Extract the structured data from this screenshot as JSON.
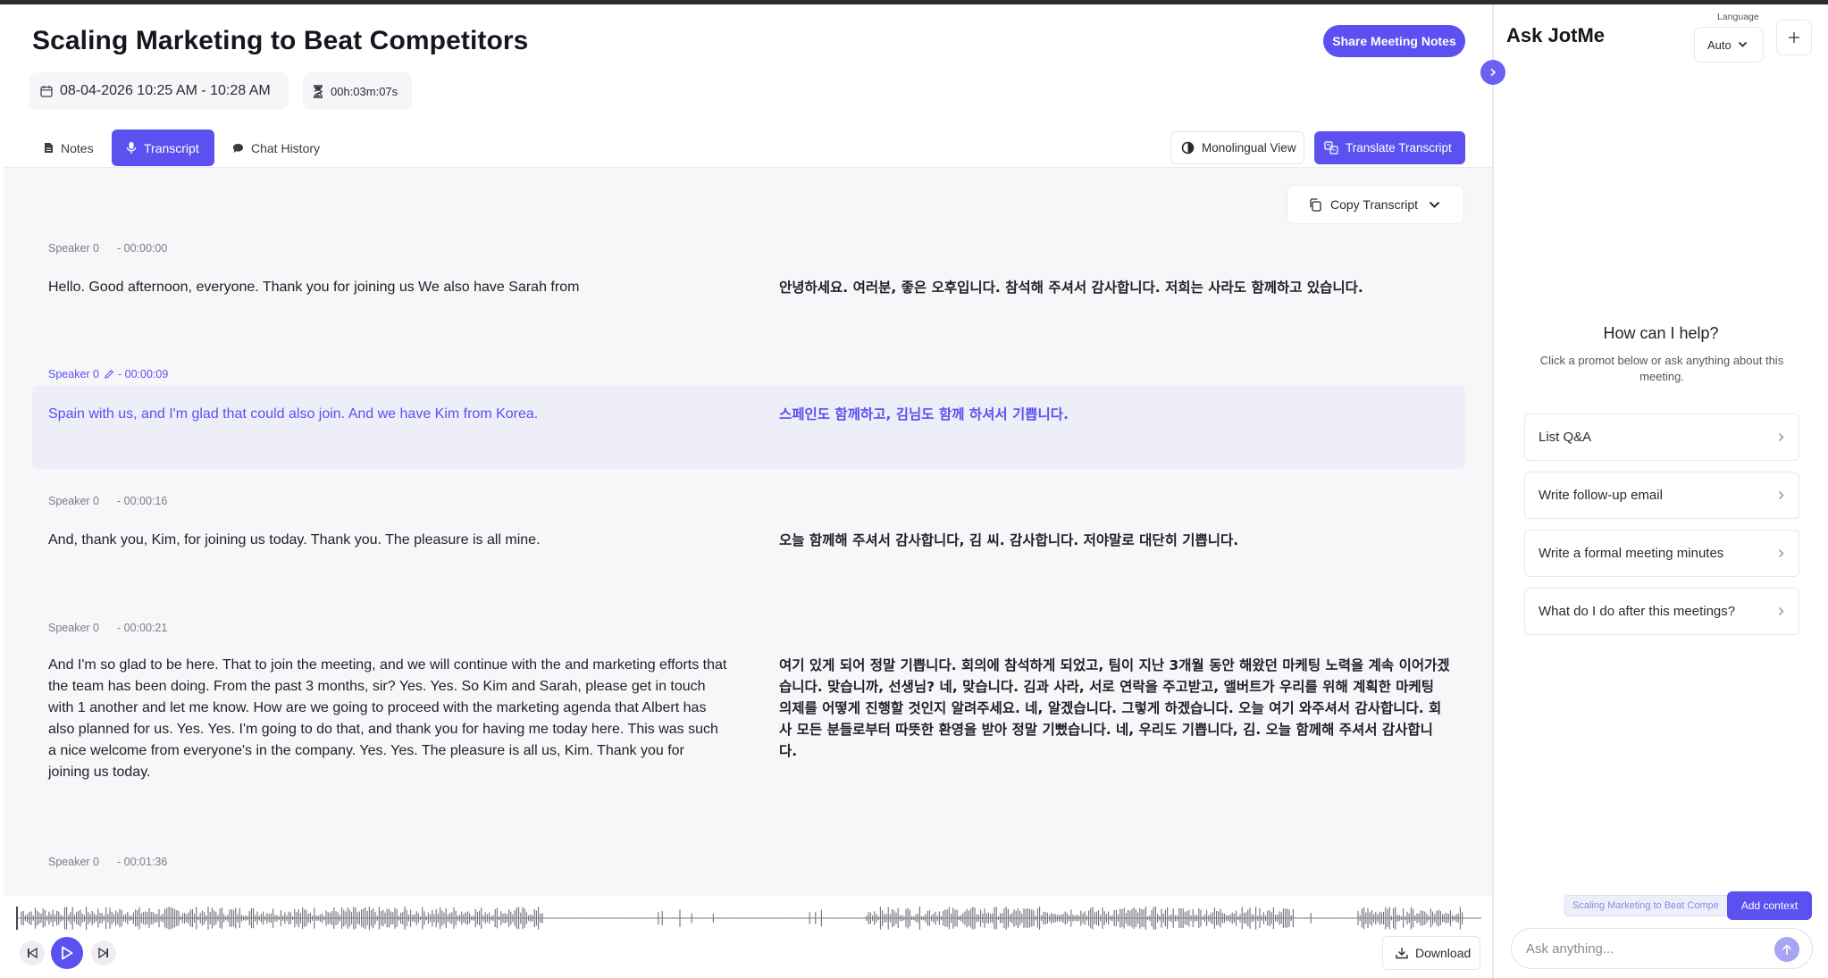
{
  "meeting": {
    "title": "Scaling Marketing to Beat Competitors",
    "share_label": "Share Meeting Notes",
    "datetime": "08-04-2026 10:25 AM - 10:28 AM",
    "duration": "00h:03m:07s"
  },
  "tabs": [
    {
      "label": "Notes",
      "icon": "file-icon"
    },
    {
      "label": "Transcript",
      "icon": "microphone-icon",
      "active": true
    },
    {
      "label": "Chat History",
      "icon": "chat-bubble-icon"
    }
  ],
  "view": {
    "monolingual_label": "Monolingual View",
    "translate_label": "Translate Transcript",
    "copy_label": "Copy Transcript"
  },
  "segments": [
    {
      "speaker": "Speaker 0",
      "time": "- 00:00:00",
      "text": "Hello. Good afternoon, everyone. Thank you for joining us We also have Sarah from",
      "translation": "안녕하세요. 여러분, 좋은 오후입니다. 참석해 주셔서 감사합니다. 저희는 사라도 함께하고 있습니다."
    },
    {
      "speaker": "Speaker 0",
      "time": "- 00:00:09",
      "text": "Spain with us, and I'm glad that could also join. And we have Kim from Korea.",
      "translation": "스페인도 함께하고, 김님도 함께 하셔서 기쁩니다.",
      "active": true
    },
    {
      "speaker": "Speaker 0",
      "time": "- 00:00:16",
      "text": "And, thank you, Kim, for joining us today. Thank you. The pleasure is all mine.",
      "translation": "오늘 함께해 주셔서 감사합니다, 김 씨. 감사합니다. 저야말로 대단히 기쁩니다."
    },
    {
      "speaker": "Speaker 0",
      "time": "- 00:00:21",
      "text": "And I'm so glad to be here. That to join the meeting, and we will continue with the and marketing efforts that the team has been doing. From the past 3 months, sir? Yes. Yes. So Kim and Sarah, please get in touch with 1 another and let me know. How are we going to proceed with the marketing agenda that Albert has also planned for us. Yes. Yes. I'm going to do that, and thank you for having me today here. This was such a nice welcome from everyone's in the company. Yes. Yes. The pleasure is all us, Kim. Thank you for joining us today.",
      "translation": "여기 있게 되어 정말 기쁩니다. 회의에 참석하게 되었고, 팀이 지난 3개월 동안 해왔던 마케팅 노력을 계속 이어가겠습니다. 맞습니까, 선생님? 네, 맞습니다. 김과 사라, 서로 연락을 주고받고, 앨버트가 우리를 위해 계획한 마케팅 의제를 어떻게 진행할 것인지 알려주세요. 네, 알겠습니다. 그렇게 하겠습니다. 오늘 여기 와주셔서 감사합니다. 회사 모든 분들로부터 따뜻한 환영을 받아 정말 기뻤습니다. 네, 우리도 기쁩니다, 김. 오늘 함께해 주셔서 감사합니다."
    },
    {
      "speaker": "Speaker 0",
      "time": "- 00:01:36",
      "text": "",
      "translation": ""
    }
  ],
  "player": {
    "download_label": "Download"
  },
  "assistant": {
    "title": "Ask JotMe",
    "language_label": "Language",
    "language_value": "Auto",
    "help_title": "How can I help?",
    "help_subtitle": "Click a promot below or ask anything about this meeting.",
    "prompts": [
      "List Q&A",
      "Write follow-up email",
      "Write a formal meeting minutes",
      "What do I do after this meetings?"
    ],
    "context_chip": "Scaling Marketing to Beat Compe",
    "add_context_label": "Add context",
    "input_placeholder": "Ask anything..."
  },
  "colors": {
    "accent": "#5b50f0",
    "active_row": "#eeeef9",
    "content_bg": "#f7f7f9"
  }
}
